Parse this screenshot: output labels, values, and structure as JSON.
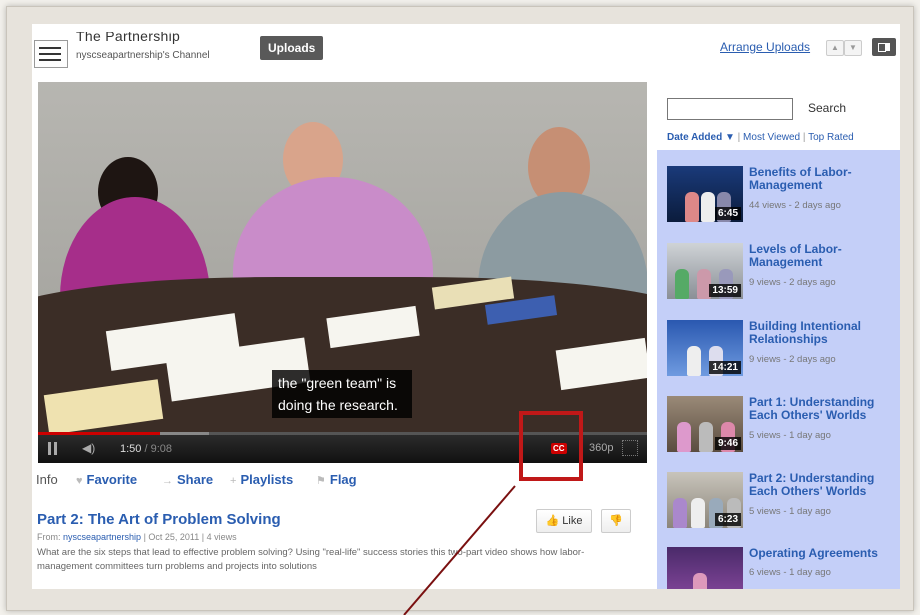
{
  "header": {
    "channel_name": "The Partnership",
    "channel_sub": "nyscseapartnership's Channel",
    "uploads_label": "Uploads",
    "arrange_label": "Arrange Uploads"
  },
  "player": {
    "caption_line1": "the \"green team\" is",
    "caption_line2": "doing the research.",
    "current_time": "1:50",
    "total_time": "/ 9:08",
    "played_fraction": 0.2,
    "buffered_fraction": 0.28,
    "cc_label": "CC",
    "quality_label": "360p"
  },
  "tabs": {
    "info": "Info",
    "favorite": "Favorite",
    "share": "Share",
    "playlists": "Playlists",
    "flag": "Flag"
  },
  "video": {
    "title": "Part 2: The Art of Problem Solving",
    "from_label": "From:",
    "from_user": "nyscseapartnership",
    "from_rest": " | Oct 25, 2011 | 4 views",
    "description": "What are the six steps that lead to effective problem solving? Using \"real-life\" success stories this two-part video shows how labor-management committees turn problems and projects into solutions",
    "like_label": "Like"
  },
  "sidebar": {
    "search_button": "Search",
    "sort_date": "Date Added",
    "sort_viewed": "Most Viewed",
    "sort_rated": "Top Rated",
    "items": [
      {
        "title1": "Benefits of Labor-",
        "title2": "Management",
        "meta": "44 views - 2 days ago",
        "duration": "6:45"
      },
      {
        "title1": "Levels of Labor-",
        "title2": "Management",
        "meta": "9 views - 2 days ago",
        "duration": "13:59"
      },
      {
        "title1": "Building Intentional",
        "title2": "Relationships",
        "meta": "9 views - 2 days ago",
        "duration": "14:21"
      },
      {
        "title1": "Part 1: Understanding",
        "title2": "Each Others' Worlds",
        "meta": "5 views - 1 day ago",
        "duration": "9:46"
      },
      {
        "title1": "Part 2: Understanding",
        "title2": "Each Others' Worlds",
        "meta": "5 views - 1 day ago",
        "duration": "6:23"
      },
      {
        "title1": "Operating Agreements",
        "title2": "",
        "meta": "6 views - 1 day ago",
        "duration": ""
      }
    ]
  },
  "colors": {
    "link": "#2a5db0",
    "highlight": "#c01818",
    "sidebar_bg": "#c4cff8"
  }
}
